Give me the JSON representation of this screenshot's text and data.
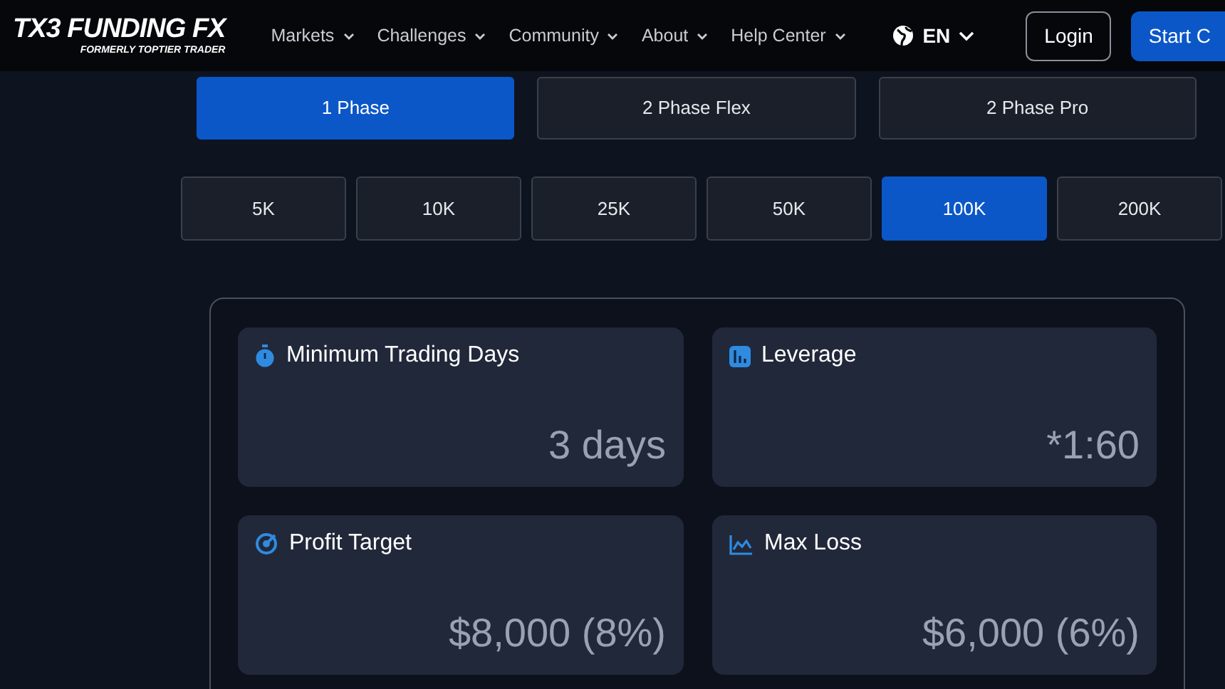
{
  "header": {
    "logo": "TX3 FUNDING FX",
    "logo_tagline": "FORMERLY TOPTIER TRADER",
    "nav": [
      "Markets",
      "Challenges",
      "Community",
      "About",
      "Help Center"
    ],
    "language": "EN",
    "login": "Login",
    "start": "Start C"
  },
  "phases": [
    {
      "label": "1 Phase",
      "selected": true
    },
    {
      "label": "2 Phase Flex",
      "selected": false
    },
    {
      "label": "2 Phase Pro",
      "selected": false
    }
  ],
  "sizes": [
    {
      "label": "5K",
      "selected": false
    },
    {
      "label": "10K",
      "selected": false
    },
    {
      "label": "25K",
      "selected": false
    },
    {
      "label": "50K",
      "selected": false
    },
    {
      "label": "100K",
      "selected": true
    },
    {
      "label": "200K",
      "selected": false
    }
  ],
  "stats": [
    {
      "title": "Minimum Trading Days",
      "value": "3 days"
    },
    {
      "title": "Leverage",
      "value": "*1:60"
    },
    {
      "title": "Profit Target",
      "value": "$8,000 (8%)"
    },
    {
      "title": "Max Loss",
      "value": "$6,000 (6%)"
    }
  ]
}
